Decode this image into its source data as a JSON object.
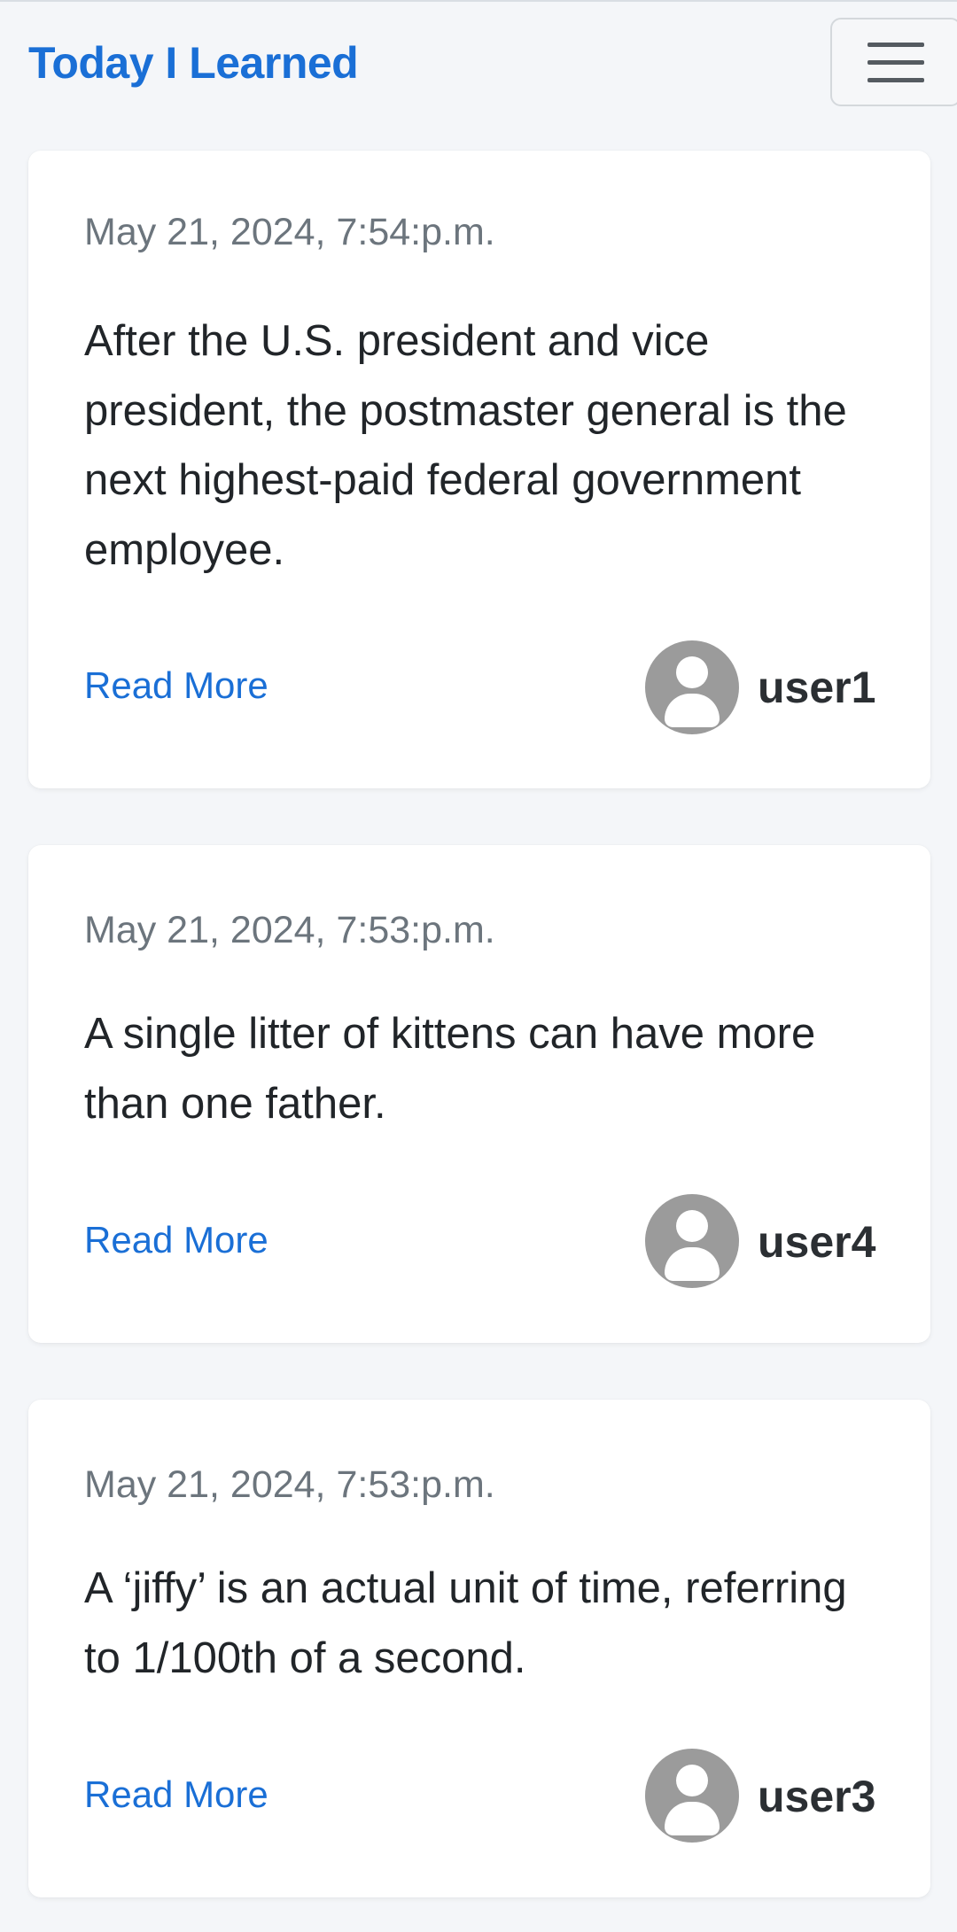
{
  "navbar": {
    "brand": "Today I Learned",
    "toggle_icon": "hamburger-menu-icon"
  },
  "posts": [
    {
      "date": "May 21, 2024, 7:54:p.m.",
      "text": "After the U.S. president and vice president, the postmaster general is the next highest-paid federal government employee.",
      "read_more": "Read More",
      "username": "user1",
      "avatar_icon": "user-avatar-icon"
    },
    {
      "date": "May 21, 2024, 7:53:p.m.",
      "text": "A single litter of kittens can have more than one father.",
      "read_more": "Read More",
      "username": "user4",
      "avatar_icon": "user-avatar-icon"
    },
    {
      "date": "May 21, 2024, 7:53:p.m.",
      "text": "A ‘jiffy’ is an actual unit of time, referring to 1/100th of a second.",
      "read_more": "Read More",
      "username": "user3",
      "avatar_icon": "user-avatar-icon"
    }
  ],
  "colors": {
    "brand": "#1a6fd6",
    "link": "#1a6fd6",
    "background": "#f4f6f9",
    "muted_text": "#6c757d",
    "avatar": "#9b9b9b"
  }
}
